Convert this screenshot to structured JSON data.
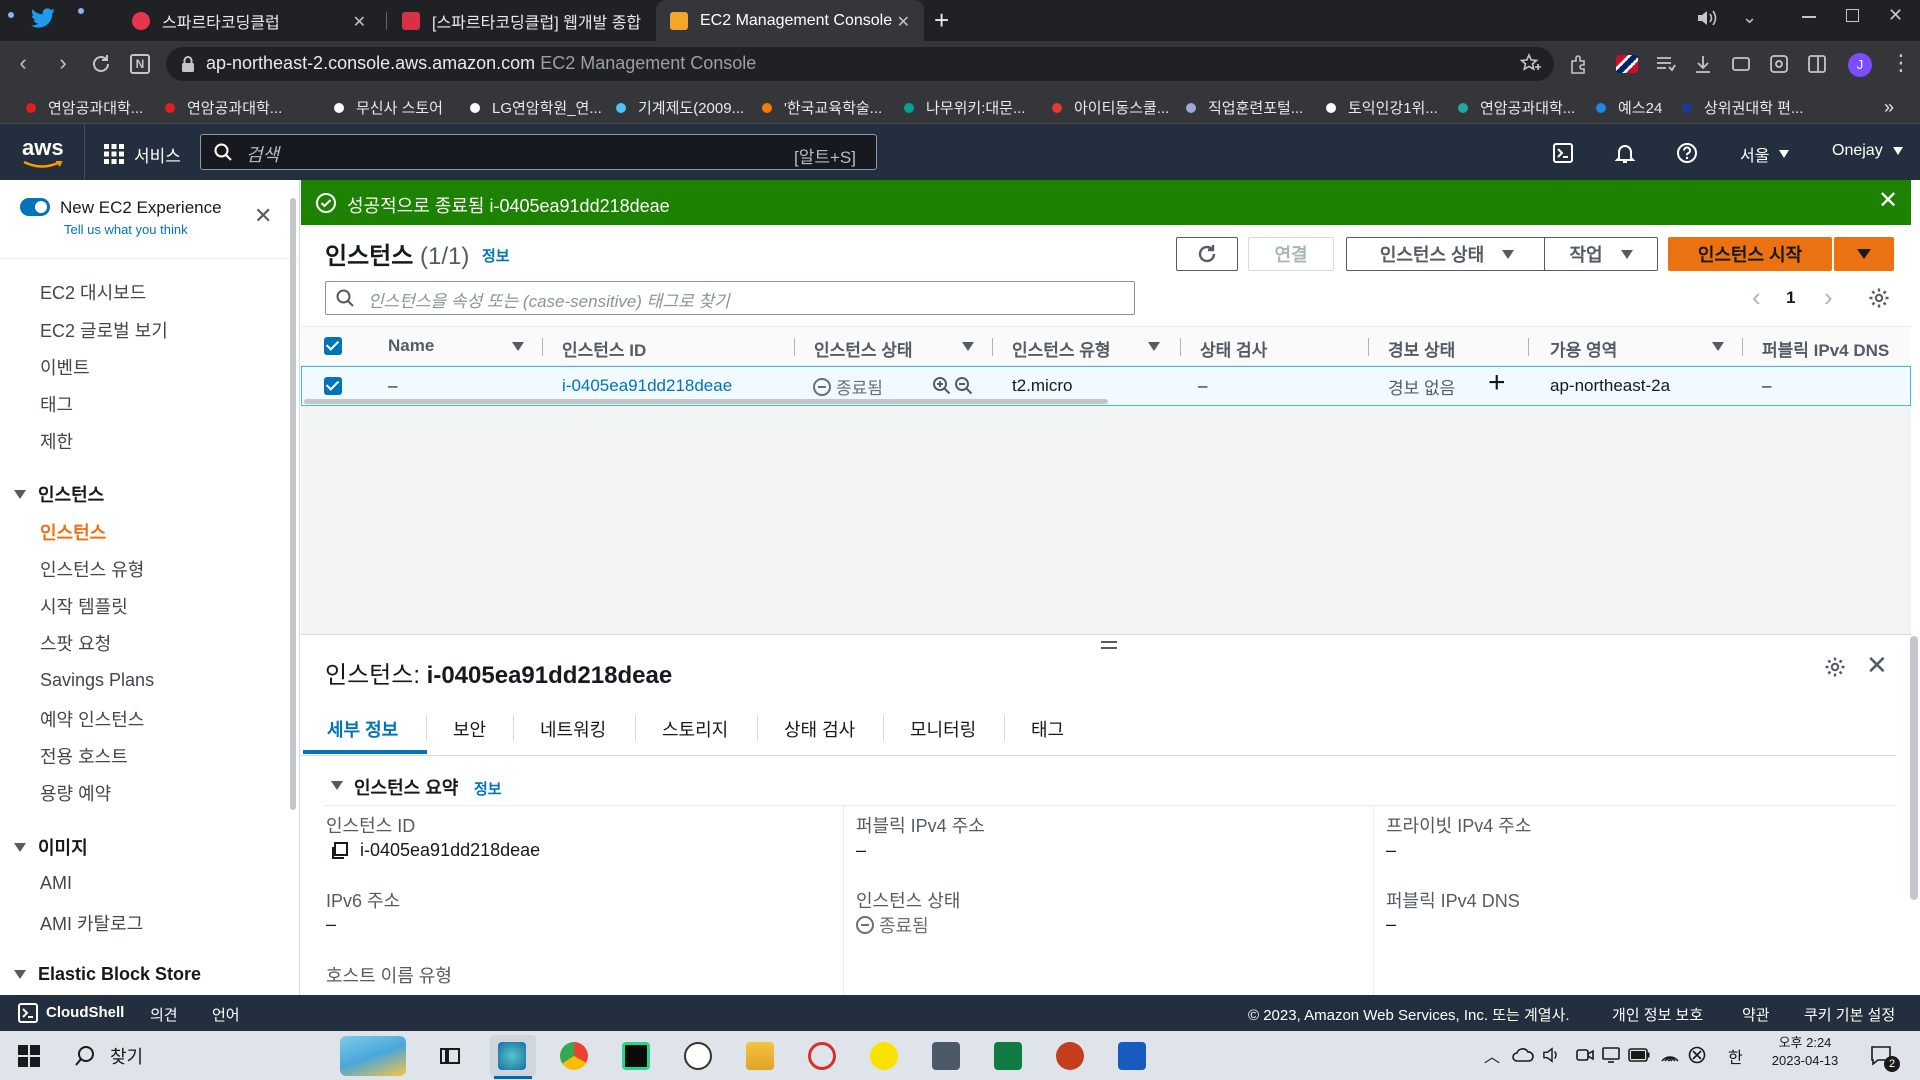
{
  "browser": {
    "tabs": [
      {
        "label": "스파르타코딩클럽",
        "active": false
      },
      {
        "label": "[스파르타코딩클럽] 웹개발 종합",
        "active": false
      },
      {
        "label": "EC2 Management Console",
        "active": true
      }
    ],
    "new_tab": "+",
    "url_host": "ap-northeast-2.console.aws.amazon.com",
    "url_title": "EC2 Management Console",
    "bookmarks": [
      {
        "label": "연암공과대학...",
        "color": "#e02020"
      },
      {
        "label": "연암공과대학...",
        "color": "#e02020"
      },
      {
        "label": "무신사 스토어",
        "color": "#ffffff"
      },
      {
        "label": "LG연암학원_연...",
        "color": "#ffffff"
      },
      {
        "label": "기계제도(2009...",
        "color": "#4fc3f7"
      },
      {
        "label": "'한국교육학술...",
        "color": "#f57c00"
      },
      {
        "label": "나무위키:대문...",
        "color": "#00a495"
      },
      {
        "label": "아이티동스쿨...",
        "color": "#e53935"
      },
      {
        "label": "직업훈련포털...",
        "color": "#9fa8da"
      },
      {
        "label": "토익인강1위...",
        "color": "#ffffff"
      },
      {
        "label": "연암공과대학...",
        "color": "#26a69a"
      },
      {
        "label": "예스24",
        "color": "#1e88e5"
      },
      {
        "label": "상위권대학 편...",
        "color": "#1a3a9a"
      }
    ],
    "more": "»"
  },
  "awsnav": {
    "logo": "aws",
    "services": "서비스",
    "search_placeholder": "검색",
    "search_shortcut": "[알트+S]",
    "region": "서울",
    "account": "Onejay"
  },
  "sidebar": {
    "new_experience": "New EC2 Experience",
    "feedback": "Tell us what you think",
    "top_items": [
      "EC2 대시보드",
      "EC2 글로벌 보기",
      "이벤트",
      "태그",
      "제한"
    ],
    "sections": [
      {
        "title": "인스턴스",
        "items": [
          "인스턴스",
          "인스턴스 유형",
          "시작 템플릿",
          "스팟 요청",
          "Savings Plans",
          "예약 인스턴스",
          "전용 호스트",
          "용량 예약"
        ]
      },
      {
        "title": "이미지",
        "items": [
          "AMI",
          "AMI 카탈로그"
        ]
      },
      {
        "title": "Elastic Block Store",
        "items": []
      }
    ],
    "active_item": "인스턴스"
  },
  "flash": {
    "message": "성공적으로 종료됨 i-0405ea91dd218deae",
    "color": "#1d8102"
  },
  "instances": {
    "title": "인스턴스",
    "count": "(1/1)",
    "info": "정보",
    "buttons": {
      "connect": "연결",
      "instance_state": "인스턴스 상태",
      "actions": "작업",
      "launch": "인스턴스 시작"
    },
    "filter_placeholder": "인스턴스을 속성 또는 (case-sensitive) 태그로 찾기",
    "page": "1",
    "columns": [
      "Name",
      "인스턴스 ID",
      "인스턴스 상태",
      "인스턴스 유형",
      "상태 검사",
      "경보 상태",
      "가용 영역",
      "퍼블릭 IPv4 DNS"
    ],
    "rows": [
      {
        "name": "–",
        "id": "i-0405ea91dd218deae",
        "state": "종료됨",
        "type": "t2.micro",
        "check": "–",
        "alarm": "경보 없음",
        "az": "ap-northeast-2a",
        "dns": "–"
      }
    ]
  },
  "details": {
    "title_prefix": "인스턴스:",
    "title_id": "i-0405ea91dd218deae",
    "tabs": [
      "세부 정보",
      "보안",
      "네트워킹",
      "스토리지",
      "상태 검사",
      "모니터링",
      "태그"
    ],
    "summary_title": "인스턴스 요약",
    "summary_info": "정보",
    "fields": {
      "instance_id_label": "인스턴스 ID",
      "instance_id_value": "i-0405ea91dd218deae",
      "public_ipv4_label": "퍼블릭 IPv4 주소",
      "public_ipv4_value": "–",
      "private_ipv4_label": "프라이빗 IPv4 주소",
      "private_ipv4_value": "–",
      "ipv6_label": "IPv6 주소",
      "ipv6_value": "–",
      "state_label": "인스턴스 상태",
      "state_value": "종료됨",
      "public_dns_label": "퍼블릭 IPv4 DNS",
      "public_dns_value": "–",
      "hostname_label": "호스트 이름 유형"
    }
  },
  "footer": {
    "cloudshell": "CloudShell",
    "feedback": "의견",
    "language": "언어",
    "copyright": "© 2023, Amazon Web Services, Inc. 또는 계열사.",
    "privacy": "개인 정보 보호",
    "terms": "약관",
    "cookies": "쿠키 기본 설정"
  },
  "taskbar": {
    "search": "찾기",
    "ime": "한",
    "time": "오후 2:24",
    "date": "2023-04-13",
    "notifications": "2"
  },
  "colors": {
    "aws_nav": "#232f3e",
    "accent_orange": "#ec7211",
    "link_blue": "#0073bb",
    "success_green": "#1d8102"
  }
}
